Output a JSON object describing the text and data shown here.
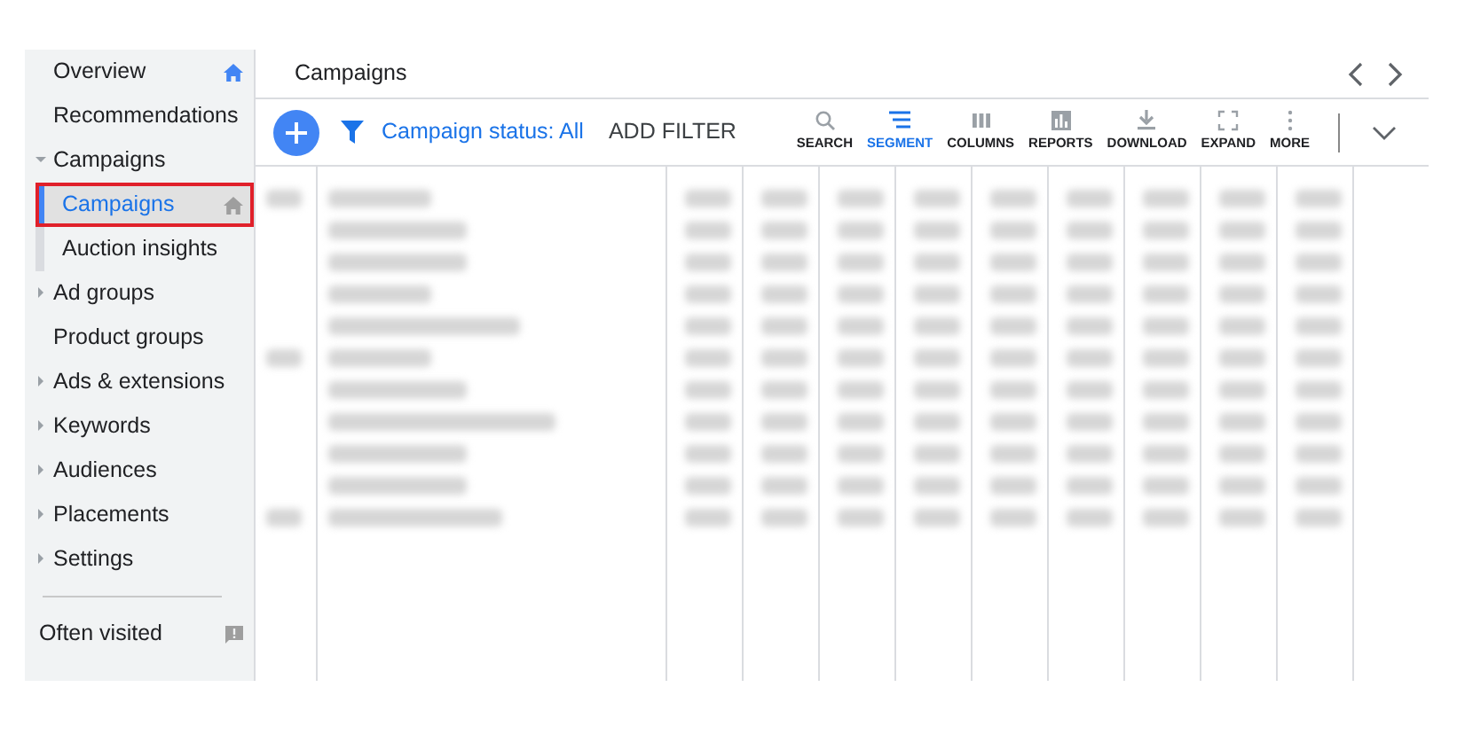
{
  "sidebar": {
    "items": [
      {
        "label": "Overview",
        "kind": "page",
        "selected": false,
        "home_default": true
      },
      {
        "label": "Recommendations",
        "kind": "page",
        "selected": false
      },
      {
        "label": "Campaigns",
        "kind": "group",
        "expanded": true,
        "selected": false,
        "children": [
          {
            "label": "Campaigns",
            "selected": true,
            "home_default": false
          },
          {
            "label": "Auction insights",
            "selected": false
          }
        ]
      },
      {
        "label": "Ad groups",
        "kind": "group",
        "expanded": false,
        "selected": false
      },
      {
        "label": "Product groups",
        "kind": "page",
        "selected": false
      },
      {
        "label": "Ads & extensions",
        "kind": "group",
        "expanded": false,
        "selected": false
      },
      {
        "label": "Keywords",
        "kind": "group",
        "expanded": false,
        "selected": false
      },
      {
        "label": "Audiences",
        "kind": "group",
        "expanded": false,
        "selected": false
      },
      {
        "label": "Placements",
        "kind": "group",
        "expanded": false,
        "selected": false
      },
      {
        "label": "Settings",
        "kind": "group",
        "expanded": false,
        "selected": false
      }
    ],
    "footer": {
      "label": "Often visited"
    }
  },
  "header": {
    "title": "Campaigns"
  },
  "toolbar": {
    "filter": "Campaign status: All",
    "add_filter": "ADD FILTER",
    "tools": [
      {
        "label": "SEARCH",
        "selected": false
      },
      {
        "label": "SEGMENT",
        "selected": true
      },
      {
        "label": "COLUMNS",
        "selected": false
      },
      {
        "label": "REPORTS",
        "selected": false
      },
      {
        "label": "DOWNLOAD",
        "selected": false
      },
      {
        "label": "EXPAND",
        "selected": false
      },
      {
        "label": "MORE",
        "selected": false
      }
    ]
  },
  "table": {
    "kind": "redacted"
  }
}
